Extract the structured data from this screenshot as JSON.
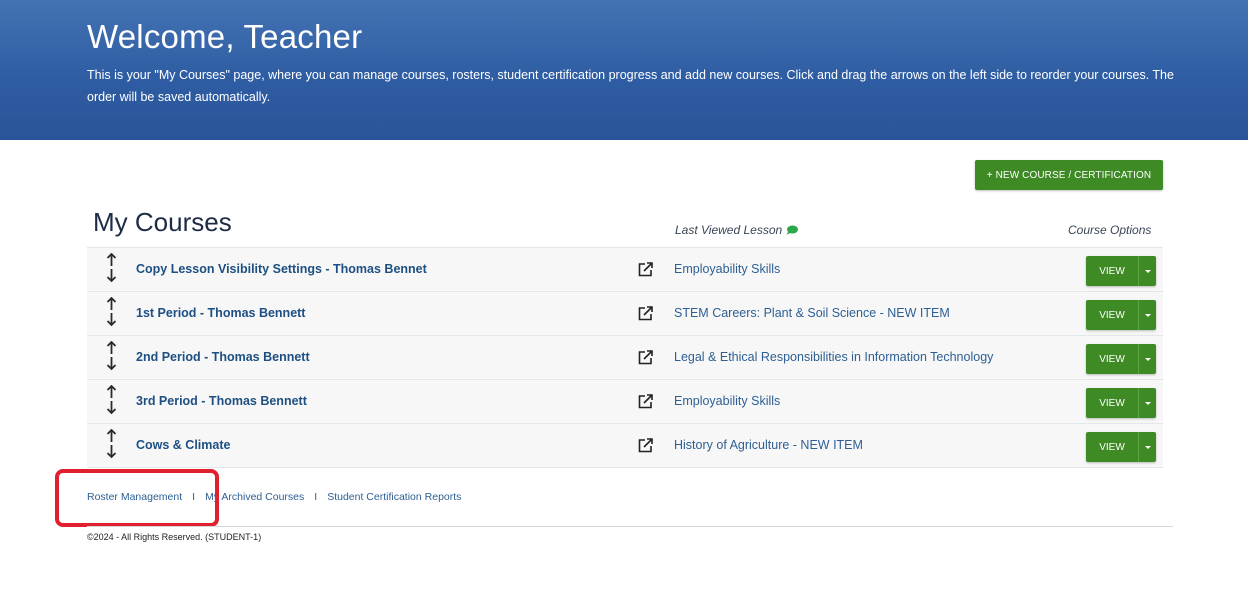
{
  "hero": {
    "title": "Welcome, Teacher",
    "description": "This is your \"My Courses\" page, where you can manage courses, rosters, student certification progress and add new courses. Click and drag the arrows on the left side to reorder your courses. The order will be saved automatically."
  },
  "toolbar": {
    "new_course_label": "+ NEW COURSE / CERTIFICATION"
  },
  "courses": {
    "title": "My Courses",
    "col_last_viewed": "Last Viewed Lesson",
    "col_options": "Course Options",
    "view_label": "VIEW",
    "rows": [
      {
        "name": "Copy Lesson Visibility Settings - Thomas Bennet",
        "lesson": "Employability Skills"
      },
      {
        "name": "1st Period - Thomas Bennett",
        "lesson": "STEM Careers: Plant & Soil Science - NEW ITEM"
      },
      {
        "name": "2nd Period - Thomas Bennett",
        "lesson": "Legal & Ethical Responsibilities in Information Technology"
      },
      {
        "name": "3rd Period - Thomas Bennett",
        "lesson": "Employability Skills"
      },
      {
        "name": "Cows & Climate",
        "lesson": "History of Agriculture - NEW ITEM"
      }
    ]
  },
  "footer": {
    "links": [
      "Roster Management",
      "My Archived Courses",
      "Student Certification Reports"
    ],
    "separator": "I",
    "copyright": "©2024 - All Rights Reserved. (STUDENT-1)"
  },
  "colors": {
    "header_blue": "#2f5da3",
    "button_green": "#3e8a25",
    "link_blue": "#2d5f93",
    "highlight_red": "#e0202f",
    "bubble_green": "#2aa84a"
  },
  "icons": {
    "reorder": "up-down-arrows-icon",
    "external": "external-link-icon",
    "comment": "chat-bubble-icon",
    "dropdown": "caret-down-icon"
  }
}
